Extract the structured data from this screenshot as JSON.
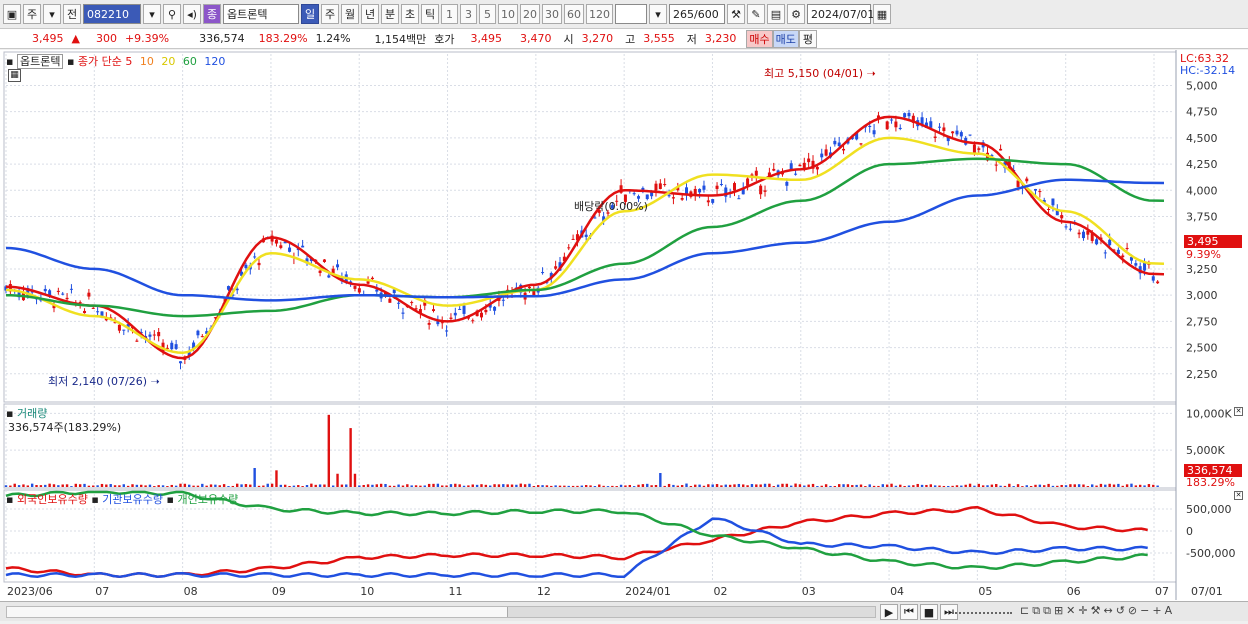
{
  "toolbar": {
    "period_label": "주",
    "prev_label": "전",
    "stock_code": "082210",
    "stock_badge": "종",
    "stock_name": "옵트론텍",
    "timeframes": [
      "일",
      "주",
      "월",
      "년",
      "분",
      "초",
      "틱"
    ],
    "minute_options": [
      "1",
      "3",
      "5",
      "10",
      "20",
      "30",
      "60",
      "120"
    ],
    "count_value": "265",
    "count_max": "/600",
    "date_value": "2024/07/01"
  },
  "quote": {
    "price": "3,495",
    "change": "300",
    "change_pct": "+9.39%",
    "volume": "336,574",
    "vol_ratio": "183.29%",
    "turnover": "1.24%",
    "amount": "1,154백만",
    "bid_label": "호가",
    "bid": "3,495",
    "ask": "3,470",
    "open_label": "시",
    "open": "3,270",
    "high_label": "고",
    "high": "3,555",
    "low_label": "저",
    "low": "3,230",
    "buy_label": "매수",
    "sell_label": "매도",
    "avg_label": "평"
  },
  "price_panel": {
    "title": "옵트론텍",
    "ma_label": "종가 단순",
    "ma_periods": [
      "5",
      "10",
      "20",
      "60",
      "120"
    ],
    "ma_colors": [
      "#e01010",
      "#f08020",
      "#f0e020",
      "#20a040",
      "#2050e0"
    ],
    "lc_label": "LC:63.32",
    "hc_label": "HC:-32.14",
    "high_marker": "최고 5,150 (04/01)",
    "low_marker": "최저 2,140 (07/26)",
    "dividend_marker": "배당락(0.00%)",
    "current_price_tag": "3,495",
    "current_pct_tag": "9.39%",
    "y_ticks": [
      "5,000",
      "4,750",
      "4,500",
      "4,250",
      "4,000",
      "3,750",
      "3,500",
      "3,250",
      "3,000",
      "2,750",
      "2,500",
      "2,250"
    ]
  },
  "volume_panel": {
    "title": "거래량",
    "value": "336,574주(183.29%)",
    "y_ticks": [
      "10,000K",
      "5,000K"
    ],
    "tag_value": "336,574",
    "tag_pct": "183.29%"
  },
  "holding_panel": {
    "series": [
      "외국인보유수량",
      "기관보유수량",
      "개인보유수량"
    ],
    "y_ticks": [
      "500,000",
      "0",
      "-500,000"
    ]
  },
  "x_axis": [
    "2023/06",
    "07",
    "08",
    "09",
    "10",
    "11",
    "12",
    "2024/01",
    "02",
    "03",
    "04",
    "05",
    "06",
    "07",
    "07/01"
  ],
  "chart_data": {
    "type": "line",
    "title": "옵트론텍",
    "price_series": [
      {
        "name": "5",
        "x": [
          "2023/06",
          "07",
          "08",
          "09",
          "10",
          "11",
          "12",
          "2024/01",
          "02",
          "03",
          "04",
          "05",
          "06",
          "07"
        ],
        "values": [
          3080,
          2900,
          2400,
          3550,
          3100,
          2750,
          3100,
          4000,
          3950,
          4200,
          4700,
          4450,
          3700,
          3200
        ]
      },
      {
        "name": "20",
        "x": [
          "2023/06",
          "07",
          "08",
          "09",
          "10",
          "11",
          "12",
          "2024/01",
          "02",
          "03",
          "04",
          "05",
          "06",
          "07"
        ],
        "values": [
          3050,
          2800,
          2450,
          3400,
          3150,
          2900,
          3050,
          3800,
          4150,
          4100,
          4500,
          4350,
          3800,
          3300
        ]
      },
      {
        "name": "60",
        "x": [
          "2023/06",
          "07",
          "08",
          "09",
          "10",
          "11",
          "12",
          "2024/01",
          "02",
          "03",
          "04",
          "05",
          "06",
          "07"
        ],
        "values": [
          3000,
          2900,
          2800,
          2850,
          3000,
          2980,
          3050,
          3300,
          3650,
          3900,
          4250,
          4300,
          4250,
          3900
        ]
      },
      {
        "name": "120",
        "x": [
          "2023/06",
          "07",
          "08",
          "09",
          "10",
          "11",
          "12",
          "2024/01",
          "02",
          "03",
          "04",
          "05",
          "06",
          "07"
        ],
        "values": [
          3450,
          3250,
          3000,
          2950,
          3000,
          2980,
          2990,
          3150,
          3400,
          3500,
          3700,
          3950,
          4100,
          4070
        ]
      }
    ],
    "high": {
      "label": "최고",
      "value": 5150,
      "date": "04/01"
    },
    "low": {
      "label": "최저",
      "value": 2140,
      "date": "07/26"
    },
    "ylim": [
      2000,
      5300
    ]
  }
}
